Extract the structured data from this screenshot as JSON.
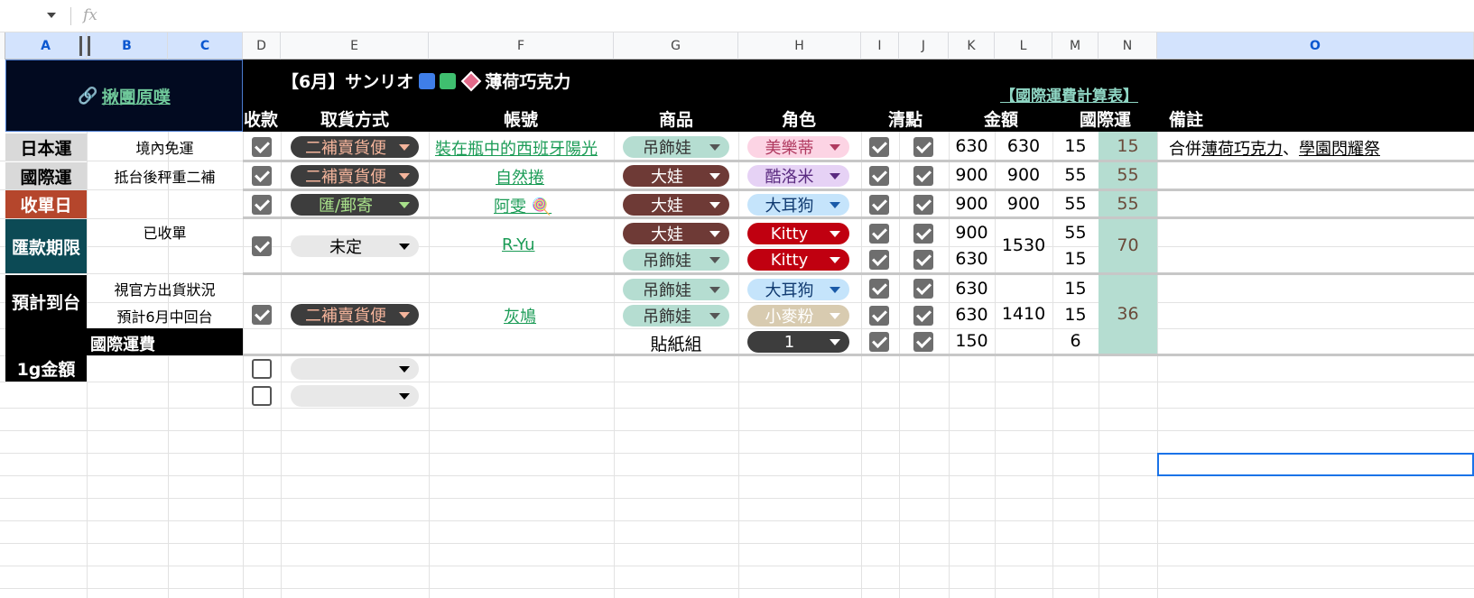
{
  "formula_bar": {
    "name_box": "",
    "fx": "fx",
    "content": ""
  },
  "columns": [
    "A",
    "B",
    "C",
    "D",
    "E",
    "F",
    "G",
    "H",
    "I",
    "J",
    "K",
    "L",
    "M",
    "N",
    "O"
  ],
  "header": {
    "group_link": "揪團原噗",
    "title": "【6月】サンリオ",
    "title_suffix": "薄荷巧克力",
    "shipping_link": "【國際運費計算表】",
    "col_received": "收款",
    "col_pickup": "取貨方式",
    "col_account": "帳號",
    "col_product": "商品",
    "col_character": "角色",
    "col_check": "清點",
    "col_amount": "金額",
    "col_intl": "國際運",
    "col_note": "備註"
  },
  "info": {
    "japan_ship": "日本運",
    "japan_ship_val": "境內免運",
    "intl_ship": "國際運",
    "intl_ship_val": "抵台後秤重二補",
    "close_date": "收單日",
    "close_status": "已收單",
    "pay_deadline": "匯款期限",
    "eta": "預計到台",
    "eta_val1": "視官方出貨狀況",
    "eta_val2": "預計6月中回台",
    "intl_fee": "國際運費",
    "per_gram": "1g金額"
  },
  "orders": [
    {
      "pickup": "二補賣貨便",
      "account": "裝在瓶中的西班牙陽光",
      "note_prefix": "合併",
      "note_link1": "薄荷巧克力",
      "note_sep": "、",
      "note_link2": "學園閃耀祭",
      "items": [
        {
          "product": "吊飾娃",
          "character": "美樂蒂",
          "amount": "630",
          "intl": "15"
        }
      ],
      "total": "630",
      "intl_total": "15"
    },
    {
      "pickup": "二補賣貨便",
      "account": "自然捲",
      "items": [
        {
          "product": "大娃",
          "character": "酷洛米",
          "amount": "900",
          "intl": "55"
        }
      ],
      "total": "900",
      "intl_total": "55"
    },
    {
      "pickup": "匯/郵寄",
      "account": "阿雯 🍭",
      "items": [
        {
          "product": "大娃",
          "character": "大耳狗",
          "amount": "900",
          "intl": "55"
        }
      ],
      "total": "900",
      "intl_total": "55"
    },
    {
      "pickup": "未定",
      "account": "R-Yu",
      "items": [
        {
          "product": "大娃",
          "character": "Kitty",
          "amount": "900",
          "intl": "55"
        },
        {
          "product": "吊飾娃",
          "character": "Kitty",
          "amount": "630",
          "intl": "15"
        }
      ],
      "total": "1530",
      "intl_total": "70"
    },
    {
      "pickup": "二補賣貨便",
      "account": "灰鳩",
      "items": [
        {
          "product": "吊飾娃",
          "character": "大耳狗",
          "amount": "630",
          "intl": "15"
        },
        {
          "product": "吊飾娃",
          "character": "小麥粉",
          "amount": "630",
          "intl": "15"
        },
        {
          "product": "貼紙組",
          "character": "1",
          "amount": "150",
          "intl": "6"
        }
      ],
      "total": "1410",
      "intl_total": "36"
    }
  ],
  "colors": {
    "header_bg": "#000000",
    "intl_col": "#b5ddd1",
    "close_date": "#b5462c",
    "pay_deadline": "#0c4a55",
    "link": "#1a9b55",
    "pickup_chip": "#3d3d3d",
    "pickup_text": "#f4b49b"
  }
}
